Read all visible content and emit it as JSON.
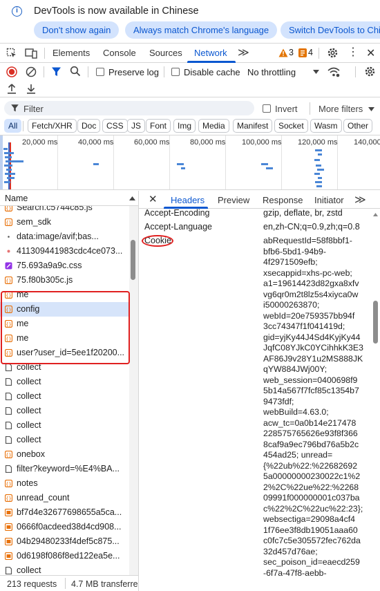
{
  "infobar": {
    "message": "DevTools is now available in Chinese",
    "btn_dont_show": "Don't show again",
    "btn_always_match": "Always match Chrome's language",
    "btn_switch": "Switch DevTools to Chi"
  },
  "tabs": {
    "elements": "Elements",
    "console": "Console",
    "sources": "Sources",
    "network": "Network",
    "more": "≫",
    "warn_count": "3",
    "error_count": "4"
  },
  "toolbar": {
    "preserve_log": "Preserve log",
    "disable_cache": "Disable cache",
    "throttling": "No throttling"
  },
  "filter": {
    "placeholder": "Filter",
    "invert": "Invert",
    "more_filters": "More filters"
  },
  "chips": [
    "All",
    "Fetch/XHR",
    "Doc",
    "CSS",
    "JS",
    "Font",
    "Img",
    "Media",
    "Manifest",
    "Socket",
    "Wasm",
    "Other"
  ],
  "overview": {
    "ticks": [
      "20,000 ms",
      "40,000 ms",
      "60,000 ms",
      "80,000 ms",
      "100,000 ms",
      "120,000 ms",
      "140,000"
    ]
  },
  "list": {
    "header": "Name",
    "rows": [
      {
        "name": "Search.c5744c85.js",
        "type": "js"
      },
      {
        "name": "sem_sdk",
        "type": "xhr"
      },
      {
        "name": "data:image/avif;bas...",
        "type": "dot"
      },
      {
        "name": "411309441983cdc4ce073...",
        "type": "img-dot"
      },
      {
        "name": "75.693a9a9c.css",
        "type": "css"
      },
      {
        "name": "75.f80b305c.js",
        "type": "xhr"
      },
      {
        "name": "me",
        "type": "xhr"
      },
      {
        "name": "config",
        "type": "xhr"
      },
      {
        "name": "me",
        "type": "xhr"
      },
      {
        "name": "me",
        "type": "xhr"
      },
      {
        "name": "user?user_id=5ee1f20200...",
        "type": "xhr"
      },
      {
        "name": "collect",
        "type": "doc"
      },
      {
        "name": "collect",
        "type": "doc"
      },
      {
        "name": "collect",
        "type": "doc"
      },
      {
        "name": "collect",
        "type": "doc"
      },
      {
        "name": "collect",
        "type": "doc"
      },
      {
        "name": "collect",
        "type": "doc"
      },
      {
        "name": "onebox",
        "type": "xhr"
      },
      {
        "name": "filter?keyword=%E4%BA...",
        "type": "doc"
      },
      {
        "name": "notes",
        "type": "xhr"
      },
      {
        "name": "unread_count",
        "type": "xhr"
      },
      {
        "name": "bf7d4e32677698655a5ca...",
        "type": "img"
      },
      {
        "name": "0666f0acdeed38d4cd908...",
        "type": "img"
      },
      {
        "name": "04b29480233f4def5c875...",
        "type": "img"
      },
      {
        "name": "0d6198f086f8ed122ea5e...",
        "type": "img"
      },
      {
        "name": "collect",
        "type": "doc"
      }
    ]
  },
  "status": {
    "requests": "213 requests",
    "transferred": "4.7 MB transferre"
  },
  "details": {
    "tabs": [
      "Headers",
      "Preview",
      "Response",
      "Initiator"
    ],
    "more": "≫",
    "headers": [
      {
        "name": "Accept-Encoding",
        "value": "gzip, deflate, br, zstd"
      },
      {
        "name": "Accept-Language",
        "value": "en,zh-CN;q=0.9,zh;q=0.8"
      }
    ],
    "cookie_label": "Cookie",
    "cookie_lines": [
      "abRequestId=58f8bbf1-",
      "bfb6-5bd1-94b9-",
      "4f2971509efb;",
      "xsecappid=xhs-pc-web;",
      "a1=19614423d82gxa8xfv",
      "vg6qr0m2t8lz5s4xiyca0w",
      "i50000263870;",
      "webId=20e759357bb94f",
      "3cc74347f1f041419d;",
      "gid=yjKy44J4Sd4KyjKy44",
      "JqfC08YJkC0YCihhkK3E3",
      "AF86J9v28Y1u2MS888JK",
      "qYW884JWj00Y;",
      "web_session=0400698f9",
      "5b14a567f7fcf85c1354b7",
      "9473fdf;",
      "webBuild=4.63.0;",
      "acw_tc=0a0b14e217478",
      "228575765626e93f8f366",
      "8caf9a9ec796bd76a5b2c",
      "454ad25; unread=",
      "{%22ub%22:%22682692",
      "5a00000000230022c1%2",
      "2%2C%22ue%22:%2268",
      "09991f000000001c037ba",
      "c%22%2C%22uc%22:23};",
      "websectiga=29098a4cf4",
      "1f76ee3f8db19051aaa60",
      "c0fc7c5e305572fec762da",
      "32d457d76ae;",
      "sec_poison_id=eaecd259",
      "-6f7a-47f8-aebb-"
    ]
  },
  "colors": {
    "accent": "#0b57d0",
    "highlight_border": "#e02020",
    "selected_row": "#d6e4fa",
    "xhr_icon": "#e8710a",
    "css_icon": "#9334e6",
    "img_icon": "#e8710a"
  }
}
